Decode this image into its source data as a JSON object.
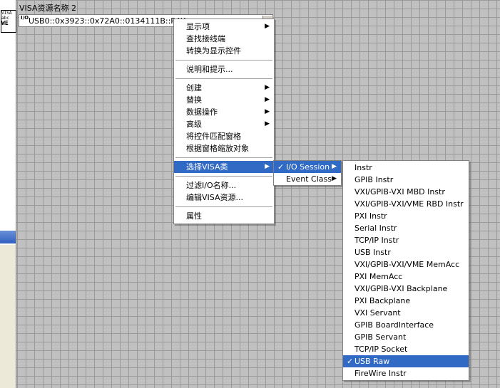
{
  "control": {
    "label": "VISA资源名称 2",
    "io_icon": "I/O",
    "value": "USB0::0x3923::0x72A0::0134111B::RAW"
  },
  "icon": {
    "line1": "VISA",
    "line2": "abc",
    "line3": "WE"
  },
  "context_menu": {
    "items": [
      {
        "label": "显示项"
      },
      {
        "label": "查找接线端"
      },
      {
        "label": "转换为显示控件"
      },
      {
        "label": "说明和提示..."
      },
      {
        "label": "创建"
      },
      {
        "label": "替换"
      },
      {
        "label": "数据操作"
      },
      {
        "label": "高级"
      },
      {
        "label": "将控件匹配窗格"
      },
      {
        "label": "根据窗格缩放对象"
      },
      {
        "label": "选择VISA类"
      },
      {
        "label": "过滤I/O名称..."
      },
      {
        "label": "编辑VISA资源..."
      },
      {
        "label": "属性"
      }
    ]
  },
  "visa_class_menu": {
    "items": [
      {
        "label": "I/O Session",
        "checked": "✓"
      },
      {
        "label": "Event Class"
      }
    ]
  },
  "io_session_menu": {
    "check": "✓",
    "items": [
      "Instr",
      "GPIB Instr",
      "VXI/GPIB-VXI MBD Instr",
      "VXI/GPIB-VXI/VME RBD Instr",
      "PXI Instr",
      "Serial Instr",
      "TCP/IP Instr",
      "USB Instr",
      "VXI/GPIB-VXI/VME MemAcc",
      "PXI MemAcc",
      "VXI/GPIB-VXI Backplane",
      "PXI Backplane",
      "VXI Servant",
      "GPIB BoardInterface",
      "GPIB Servant",
      "TCP/IP Socket",
      "USB Raw",
      "FireWire Instr"
    ],
    "selected": "USB Raw"
  },
  "colors": {
    "highlight": "#316ac5",
    "grid": "#9a9a9a",
    "background": "#c0c0c0"
  }
}
